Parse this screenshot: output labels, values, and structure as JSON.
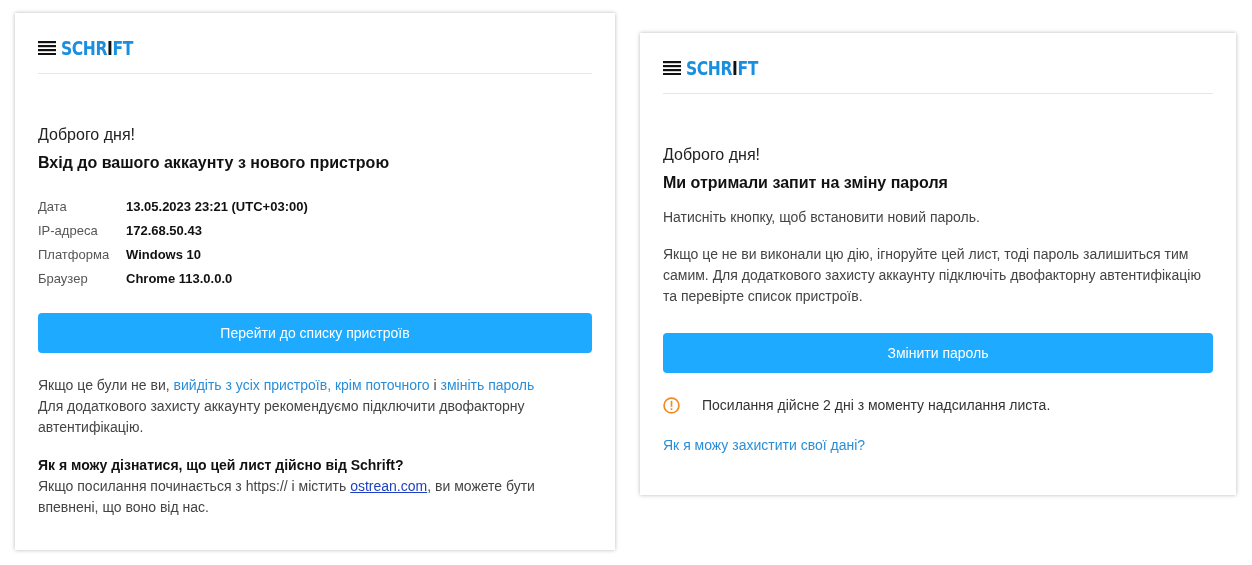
{
  "cards": [
    {
      "logo": [
        {
          "text": "SCHR",
          "highlight": false
        },
        {
          "text": "I",
          "highlight": true
        },
        {
          "text": "FT",
          "highlight": false
        }
      ],
      "greeting": "Доброго дня!",
      "heading": "Вхід до вашого аккаунту з нового пристрою",
      "details": [
        {
          "label": "Дата",
          "value": "13.05.2023 23:21 (UTC+03:00)"
        },
        {
          "label": "IP-адреса",
          "value": "172.68.50.43"
        },
        {
          "label": "Платформа",
          "value": "Windows 10"
        },
        {
          "label": "Браузер",
          "value": "Chrome 113.0.0.0"
        }
      ],
      "button": "Перейти до списку пристроїв",
      "after": [
        {
          "kind": "segments",
          "segments": [
            {
              "kind": "text",
              "text": "Якщо це були не ви, "
            },
            {
              "kind": "link",
              "text": "вийдіть з усіх пристроїв, крім поточного"
            },
            {
              "kind": "text",
              "text": " і "
            },
            {
              "kind": "link",
              "text": "змініть пароль"
            }
          ]
        },
        {
          "kind": "text",
          "text": "Для додаткового захисту аккаунту рекомендуємо підключити двофакторну автентифікацію."
        },
        {
          "kind": "question",
          "text": "Як я можу дізнатися, що цей лист дійсно від Schrift?"
        },
        {
          "kind": "segments",
          "segments": [
            {
              "kind": "text",
              "text": "Якщо посилання починається з https:// і містить "
            },
            {
              "kind": "url",
              "text": "ostrean.com"
            },
            {
              "kind": "text",
              "text": ", ви можете бути впевнені, що воно від нас."
            }
          ]
        }
      ]
    },
    {
      "logo": [
        {
          "text": "SCHR",
          "highlight": false
        },
        {
          "text": "I",
          "highlight": true
        },
        {
          "text": "FT",
          "highlight": false
        }
      ],
      "greeting": "Доброго дня!",
      "heading": "Ми отримали запит на зміну пароля",
      "intro": [
        "Натисніть кнопку, щоб встановити новий пароль.",
        "Якщо це не ви виконали цю дію, ігноруйте цей лист, тоді пароль залишиться тим самим. Для додаткового захисту аккаунту підключіть двофакторну автентифікацію та перевірте список пристроїв."
      ],
      "button": "Змінити пароль",
      "after": [
        {
          "kind": "warning",
          "text": "Посилання дійсне 2 дні з моменту надсилання листа."
        },
        {
          "kind": "help-link",
          "text": "Як я можу захистити свої дані?"
        }
      ]
    }
  ]
}
